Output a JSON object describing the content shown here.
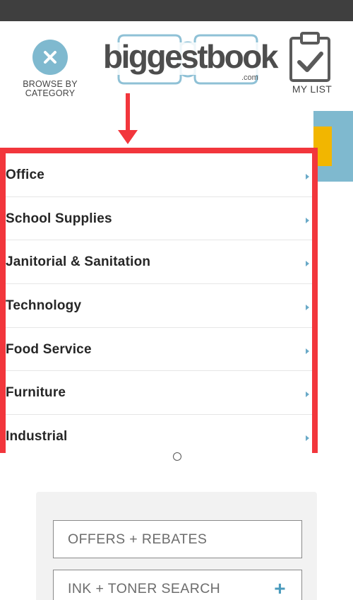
{
  "header": {
    "browse_label_line1": "BROWSE BY",
    "browse_label_line2": "CATEGORY",
    "logo_text": "biggestbook",
    "logo_suffix": ".com",
    "logo_reg": "®",
    "mylist_label": "MY LIST"
  },
  "menu": {
    "items": [
      {
        "label": "Office"
      },
      {
        "label": "School Supplies"
      },
      {
        "label": "Janitorial & Sanitation"
      },
      {
        "label": "Technology"
      },
      {
        "label": "Food Service"
      },
      {
        "label": "Furniture"
      },
      {
        "label": "Industrial"
      }
    ]
  },
  "panel": {
    "offers_label": "OFFERS + REBATES",
    "ink_label": "INK + TONER SEARCH",
    "ink_icon": "+"
  },
  "colors": {
    "accent_blue": "#7fb9cf",
    "highlight_red": "#f2363c",
    "status_bar": "#3f3f3f"
  }
}
